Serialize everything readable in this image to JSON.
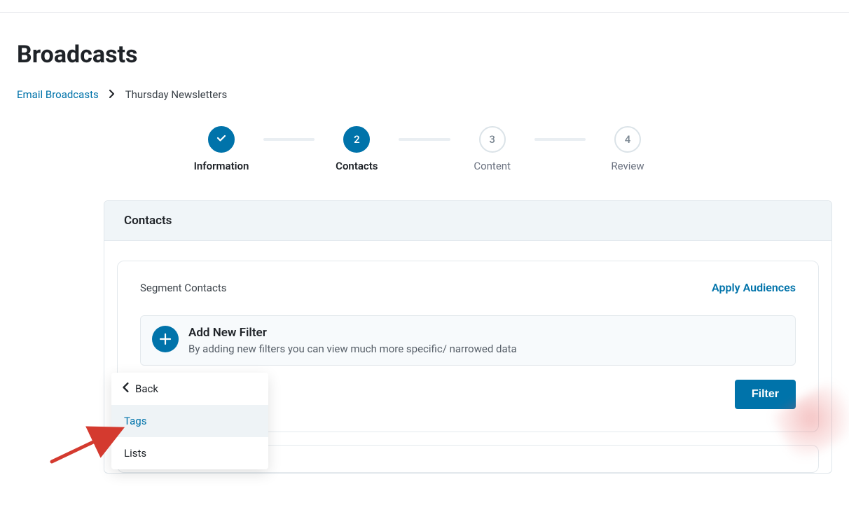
{
  "page": {
    "title": "Broadcasts"
  },
  "breadcrumb": {
    "root": "Email Broadcasts",
    "current": "Thursday Newsletters"
  },
  "stepper": {
    "steps": [
      {
        "label": "Information",
        "marker": "check"
      },
      {
        "label": "Contacts",
        "marker": "2"
      },
      {
        "label": "Content",
        "marker": "3"
      },
      {
        "label": "Review",
        "marker": "4"
      }
    ]
  },
  "panel": {
    "header": "Contacts",
    "segment_label": "Segment Contacts",
    "apply_audiences": "Apply Audiences",
    "add_filter": {
      "title": "Add New Filter",
      "desc": "By adding new filters you can view much more specific/ narrowed data"
    },
    "filter_button": "Filter"
  },
  "dropdown": {
    "back": "Back",
    "items": [
      {
        "label": "Tags",
        "hover": true
      },
      {
        "label": "Lists",
        "hover": false
      }
    ]
  },
  "colors": {
    "accent": "#0073aa"
  }
}
